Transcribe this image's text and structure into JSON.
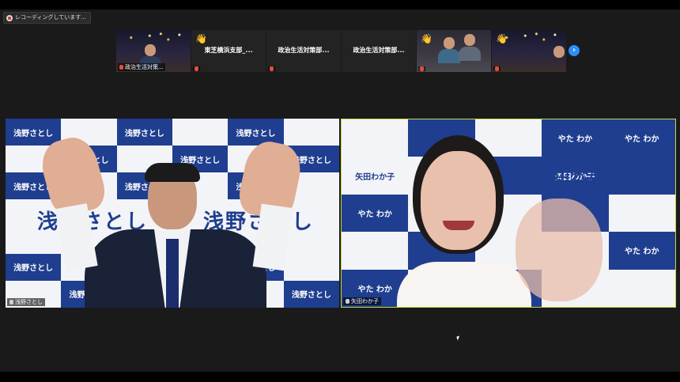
{
  "recording": {
    "label": "レコーディングしています..."
  },
  "participant_strip": {
    "thumbnails": [
      {
        "name": "政治生活対策...",
        "type": "video"
      },
      {
        "name": "東芝横浜支部_...",
        "type": "name",
        "hand": "👋"
      },
      {
        "name": "政治生活対策部...",
        "type": "name"
      },
      {
        "name": "政治生活対策部...",
        "type": "name"
      },
      {
        "name": "",
        "type": "video",
        "hand": "👋"
      },
      {
        "name": "",
        "type": "video",
        "hand": "👋"
      }
    ],
    "next_icon": "›"
  },
  "main_tiles": {
    "left": {
      "name": "浅野さとし",
      "banner_cell": "浅野さとし",
      "big_text": "浅野さとし"
    },
    "right": {
      "name": "矢田わか子",
      "cell_a": "やた わか",
      "cell_b": "矢田わか子",
      "big_text": "矢田わか子"
    }
  },
  "colors": {
    "active_speaker_border": "#c6d84a",
    "banner_blue": "#1f3e8f",
    "next_button": "#2d8cff"
  }
}
